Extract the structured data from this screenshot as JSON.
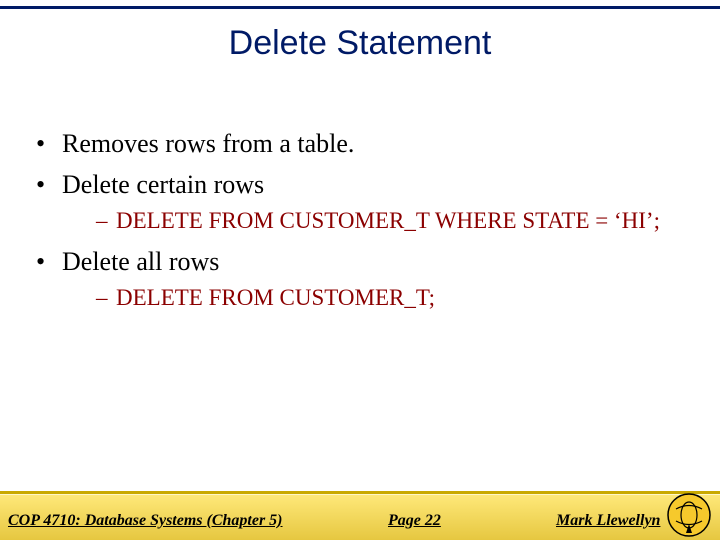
{
  "title": "Delete Statement",
  "bullets": {
    "b1": "Removes rows from a table.",
    "b2": "Delete certain rows",
    "b2_sub": "DELETE FROM CUSTOMER_T WHERE STATE = ‘HI’;",
    "b3": "Delete all rows",
    "b3_sub": "DELETE FROM CUSTOMER_T;"
  },
  "footer": {
    "course": "COP 4710: Database Systems  (Chapter 5)",
    "page": "Page 22",
    "author": "Mark Llewellyn"
  }
}
